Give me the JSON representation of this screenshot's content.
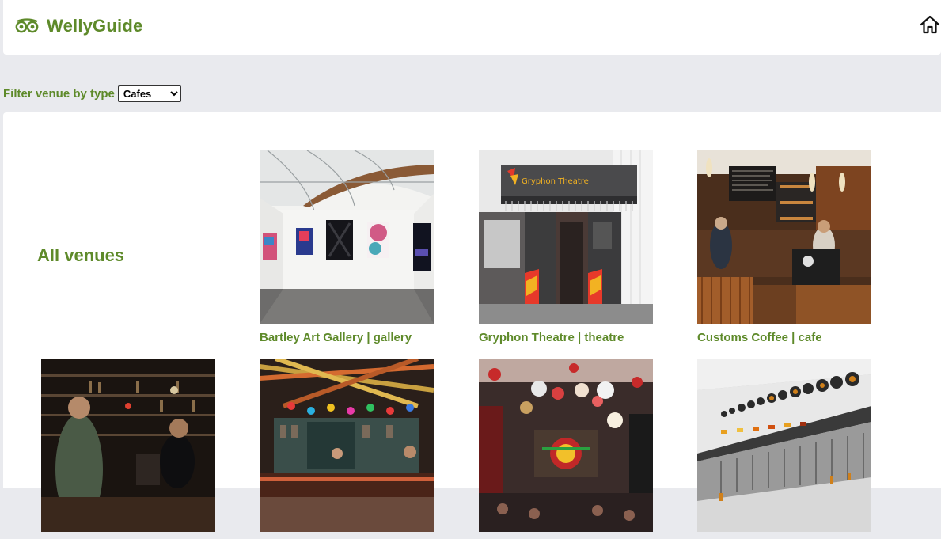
{
  "header": {
    "brand_name": "WellyGuide",
    "logo_icon": "owl-eyes-icon",
    "home_icon": "home-icon"
  },
  "filter": {
    "label": "Filter venue by type",
    "selected": "Cafes"
  },
  "main": {
    "heading": "All venues",
    "venues": [
      {
        "caption": "Bartley Art Gallery | gallery"
      },
      {
        "caption": "Gryphon Theatre | theatre"
      },
      {
        "caption": "Customs Coffee | cafe"
      },
      {
        "caption": ""
      },
      {
        "caption": ""
      },
      {
        "caption": ""
      },
      {
        "caption": ""
      }
    ]
  },
  "colors": {
    "accent": "#5e8a2a",
    "page_bg": "#e9eaee",
    "panel_bg": "#ffffff"
  }
}
